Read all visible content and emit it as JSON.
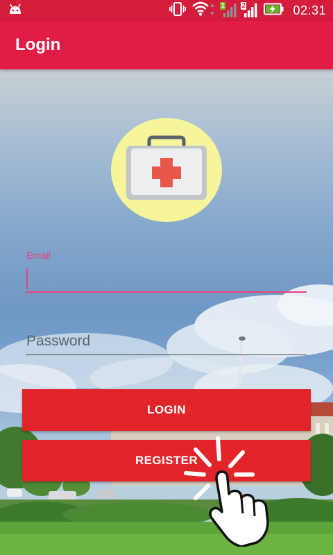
{
  "status_bar": {
    "time": "02:31",
    "sim1_label": "1",
    "sim2_label": "2",
    "icons": [
      "android-icon",
      "vibrate-icon",
      "wifi-icon",
      "signal-sim1-icon",
      "signal-sim2-icon",
      "battery-charging-icon"
    ]
  },
  "app_bar": {
    "title": "Login"
  },
  "form": {
    "email_label": "Email",
    "email_value": "",
    "password_placeholder": "Password",
    "password_value": "",
    "login_label": "LOGIN",
    "register_label": "REGISTER"
  },
  "colors": {
    "status_bar": "#d41c3c",
    "app_bar": "#e21d45",
    "accent": "#e8437a",
    "button": "#e0242a",
    "logo_circle": "#f6f59c",
    "medical_cross": "#e8574a"
  }
}
